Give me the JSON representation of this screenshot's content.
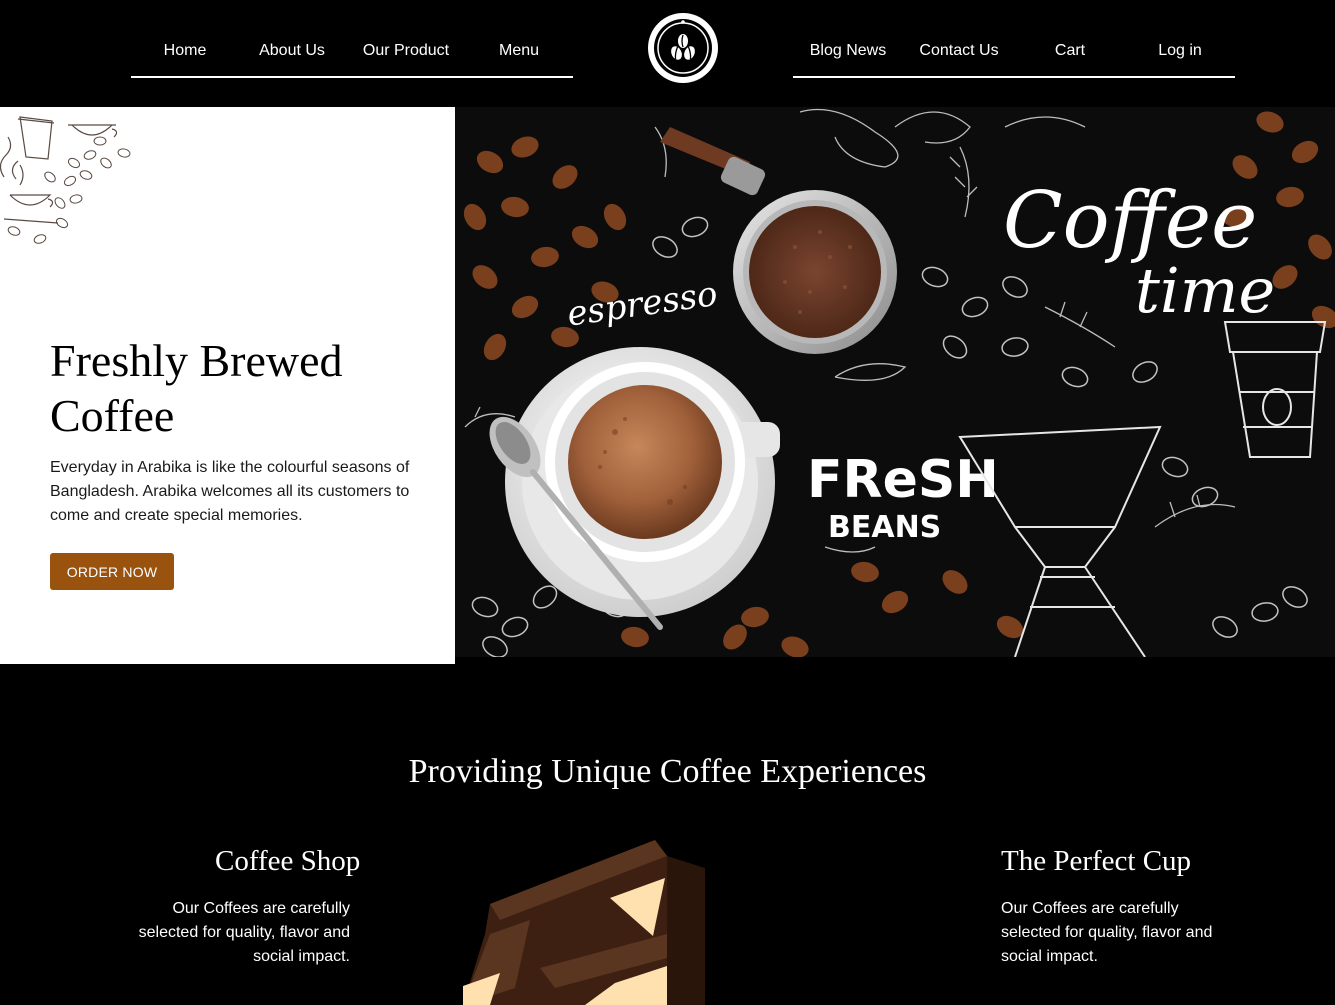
{
  "nav": {
    "left": [
      {
        "label": "Home"
      },
      {
        "label": "About Us"
      },
      {
        "label": "Our Product"
      },
      {
        "label": "Menu"
      }
    ],
    "right": [
      {
        "label": "Blog News"
      },
      {
        "label": "Contact Us"
      },
      {
        "label": "Cart"
      },
      {
        "label": "Log in"
      }
    ],
    "logo_icon": "coffee-beans-logo-icon"
  },
  "hero": {
    "title": "Freshly Brewed Coffee",
    "text": "Everyday in Arabika is like the colourful seasons of Bangladesh. Arabika welcomes all its customers to come and create special memories.",
    "button_label": "ORDER NOW",
    "button_color": "#9a520f",
    "image": {
      "lettering_espresso": "espresso",
      "lettering_coffee": "Coffee",
      "lettering_time": "time",
      "lettering_fresh": "FReSH",
      "lettering_beans": "BEANS"
    }
  },
  "experiences": {
    "title": "Providing Unique Coffee Experiences",
    "left": {
      "title": "Coffee Shop",
      "text": "Our Coffees are carefully selected for quality, flavor and social impact."
    },
    "right": {
      "title": "The Perfect Cup",
      "text": "Our Coffees are carefully selected for quality, flavor and social impact."
    }
  }
}
